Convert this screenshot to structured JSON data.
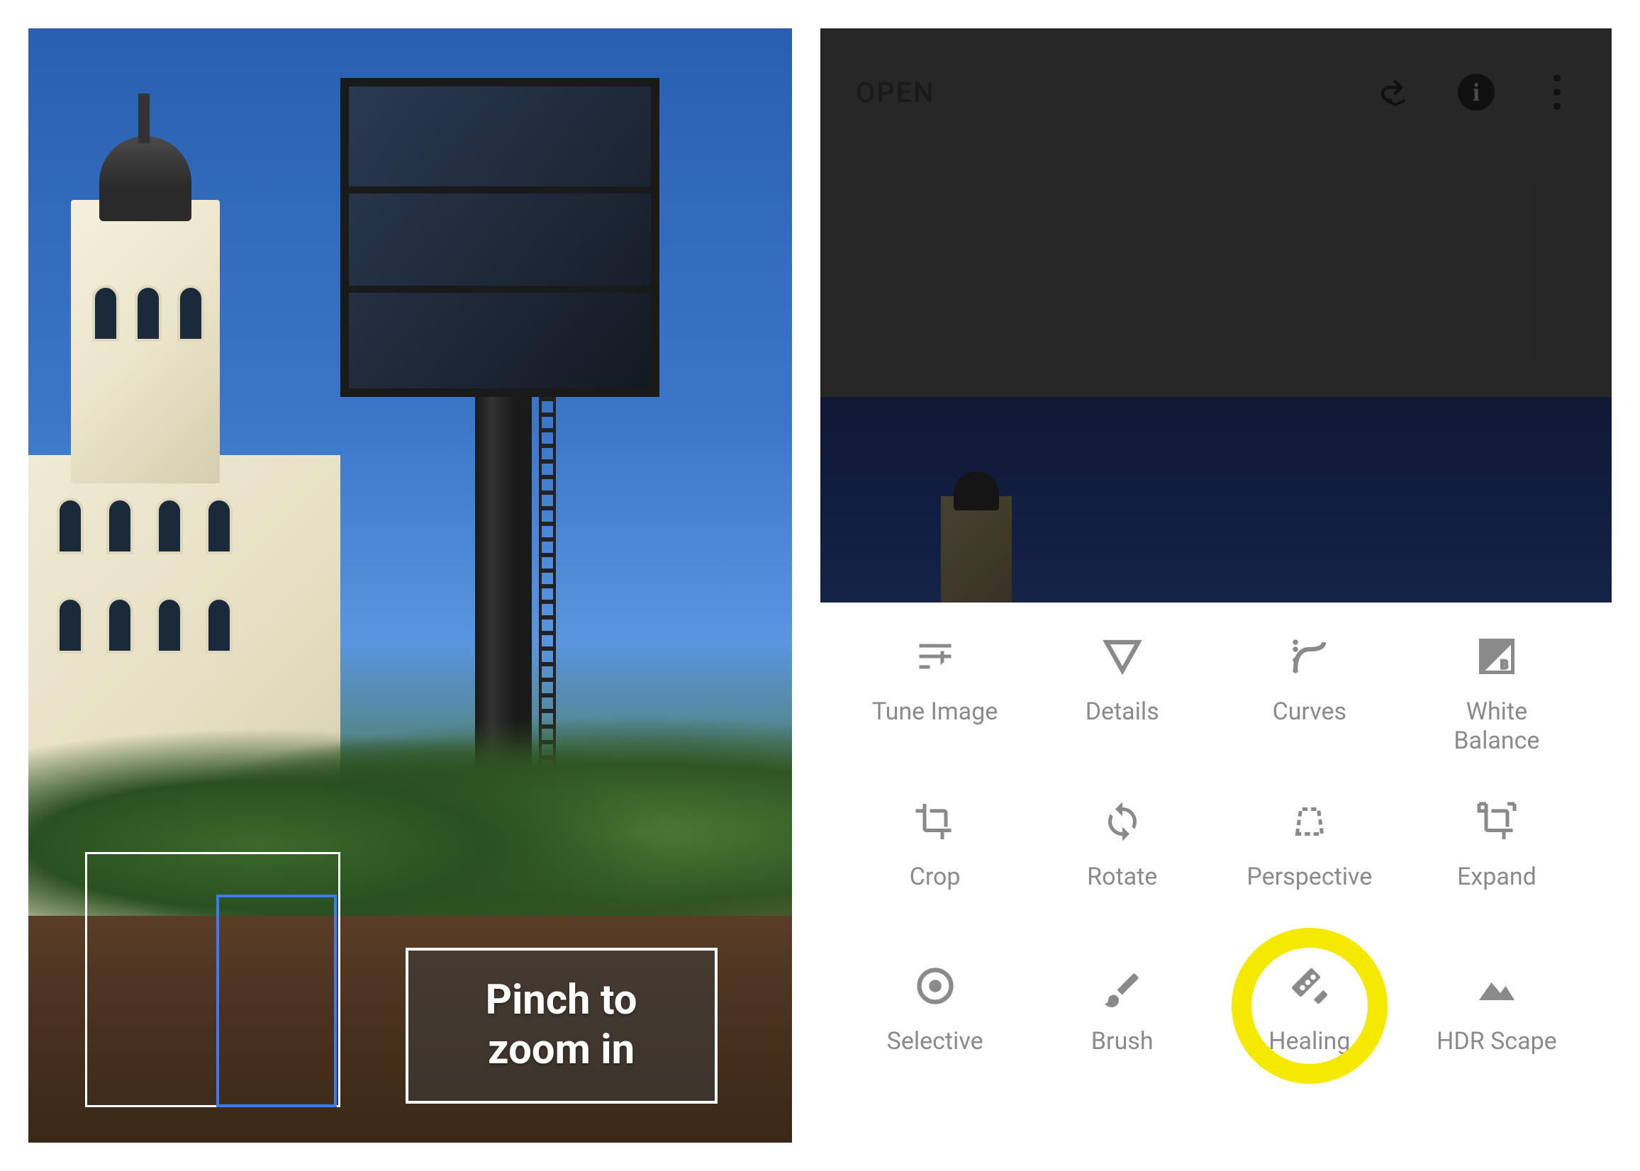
{
  "left": {
    "hint_line1": "Pinch to",
    "hint_line2": "zoom in"
  },
  "app": {
    "open_label": "OPEN",
    "header_icons": {
      "undo_layers": "undo-layers-icon",
      "info": "info-icon",
      "overflow": "overflow-menu-icon"
    }
  },
  "tools": [
    {
      "id": "tune-image",
      "label": "Tune Image",
      "icon": "tune-icon"
    },
    {
      "id": "details",
      "label": "Details",
      "icon": "details-icon"
    },
    {
      "id": "curves",
      "label": "Curves",
      "icon": "curves-icon"
    },
    {
      "id": "white-balance",
      "label": "White Balance",
      "icon": "wb-icon"
    },
    {
      "id": "crop",
      "label": "Crop",
      "icon": "crop-icon"
    },
    {
      "id": "rotate",
      "label": "Rotate",
      "icon": "rotate-icon"
    },
    {
      "id": "perspective",
      "label": "Perspective",
      "icon": "perspective-icon"
    },
    {
      "id": "expand",
      "label": "Expand",
      "icon": "expand-icon"
    },
    {
      "id": "selective",
      "label": "Selective",
      "icon": "selective-icon"
    },
    {
      "id": "brush",
      "label": "Brush",
      "icon": "brush-icon"
    },
    {
      "id": "healing",
      "label": "Healing",
      "icon": "healing-icon",
      "highlighted": true
    },
    {
      "id": "hdr-scape",
      "label": "HDR Scape",
      "icon": "hdr-icon"
    }
  ]
}
